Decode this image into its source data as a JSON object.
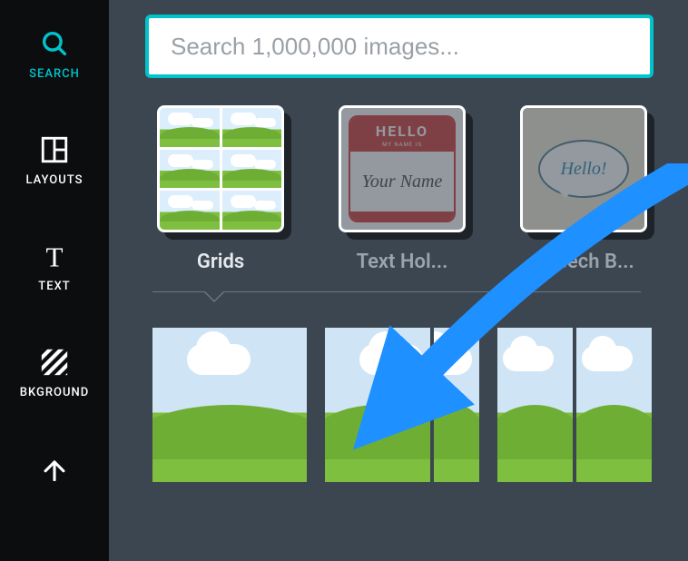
{
  "sidebar": {
    "items": [
      {
        "id": "search",
        "label": "SEARCH",
        "icon": "search-icon",
        "active": true
      },
      {
        "id": "layouts",
        "label": "LAYOUTS",
        "icon": "layouts-icon",
        "active": false
      },
      {
        "id": "text",
        "label": "TEXT",
        "icon": "text-icon",
        "active": false
      },
      {
        "id": "bkground",
        "label": "BKGROUND",
        "icon": "background-icon",
        "active": false
      },
      {
        "id": "uploads",
        "label": "",
        "icon": "upload-arrow-icon",
        "active": false
      }
    ]
  },
  "search": {
    "placeholder": "Search 1,000,000 images...",
    "value": ""
  },
  "categories": [
    {
      "id": "grids",
      "label": "Grids",
      "thumb": "grids",
      "selected": true
    },
    {
      "id": "text",
      "label": "Text Hol...",
      "thumb": "tag",
      "selected": false
    },
    {
      "id": "speech",
      "label": "Speech B...",
      "thumb": "bubble",
      "selected": false
    }
  ],
  "tag_thumb": {
    "top": "HELLO",
    "sub": "MY NAME IS",
    "name": "Your Name"
  },
  "bubble_thumb": {
    "text": "Hello!"
  },
  "annotation": {
    "type": "arrow",
    "color": "#1e90ff"
  }
}
